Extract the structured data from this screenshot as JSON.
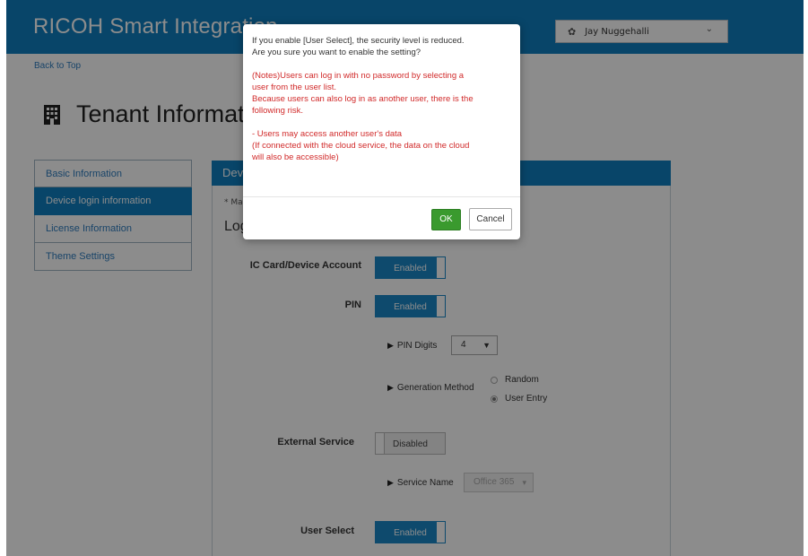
{
  "header": {
    "app_title": "RICOH Smart Integration",
    "user_name": "Jay Nuggehalli"
  },
  "nav": {
    "back_link": "Back to Top"
  },
  "page": {
    "title": "Tenant Information"
  },
  "sidebar": {
    "items": [
      {
        "label": "Basic Information",
        "active": false
      },
      {
        "label": "Device login information",
        "active": true
      },
      {
        "label": "License Information",
        "active": false
      },
      {
        "label": "Theme Settings",
        "active": false
      }
    ]
  },
  "panel": {
    "header": "Device login information",
    "mandatory_note": "* Ma",
    "section_title": "Log",
    "fields": {
      "ic_card": {
        "label": "IC Card/Device Account",
        "state": "Enabled"
      },
      "pin": {
        "label": "PIN",
        "state": "Enabled"
      },
      "pin_digits": {
        "label": "PIN Digits",
        "value": "4"
      },
      "generation_method": {
        "label": "Generation Method",
        "options": [
          "Random",
          "User Entry"
        ],
        "selected": "User Entry"
      },
      "external_service": {
        "label": "External Service",
        "state": "Disabled"
      },
      "service_name": {
        "label": "Service Name",
        "value": "Office 365"
      },
      "user_select": {
        "label": "User Select",
        "state": "Enabled"
      }
    }
  },
  "dialog": {
    "question_line1": "If you enable [User Select], the security level is reduced.",
    "question_line2": "Are you sure you want to enable the setting?",
    "note_line1": "(Notes)Users can log in with no password by selecting a",
    "note_line2": "user from the user list.",
    "note_line3": "Because users can also log in as another user, there is the",
    "note_line4": "following risk.",
    "risk_line1": "- Users may access another user's data",
    "risk_line2": "(If connected with the cloud service, the data on the cloud",
    "risk_line3": "will also be accessible)",
    "ok_label": "OK",
    "cancel_label": "Cancel"
  },
  "colors": {
    "header_blue": "#0f7ec0",
    "warning_red": "#d12a2a",
    "ok_green": "#3a9a2e",
    "highlight_yellow": "#fff500"
  }
}
